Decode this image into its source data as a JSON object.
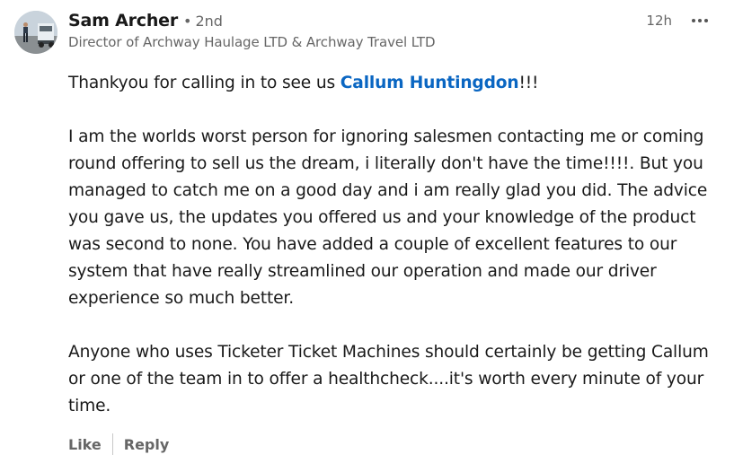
{
  "comment": {
    "author": {
      "name": "Sam Archer",
      "degree_separator": "•",
      "degree": "2nd",
      "headline": "Director of Archway Haulage LTD & Archway Travel LTD",
      "avatar": "truck-photo"
    },
    "timestamp": "12h",
    "more_icon": "ellipsis-icon",
    "body": {
      "p1_before": "Thankyou for calling in to see us ",
      "mention": "Callum Huntingdon",
      "p1_after": "!!!",
      "p2": "I am the worlds worst person for ignoring salesmen contacting me or coming round offering to sell us the dream, i literally don't have the time!!!!. But you managed to catch me on a good day and i am really glad you did. The advice you gave us, the updates you offered us and your knowledge of the product was second to none. You have added a couple of excellent features to our system that have really streamlined our operation and made our driver experience so much better.",
      "p3": "Anyone who uses Ticketer Ticket Machines should certainly be getting Callum or one of the team in to offer a healthcheck....it's worth every minute of your time."
    },
    "actions": {
      "like_label": "Like",
      "reply_label": "Reply"
    }
  },
  "colors": {
    "text": "#191919",
    "secondary": "#666666",
    "mention": "#0a66c2",
    "background": "#ffffff"
  }
}
